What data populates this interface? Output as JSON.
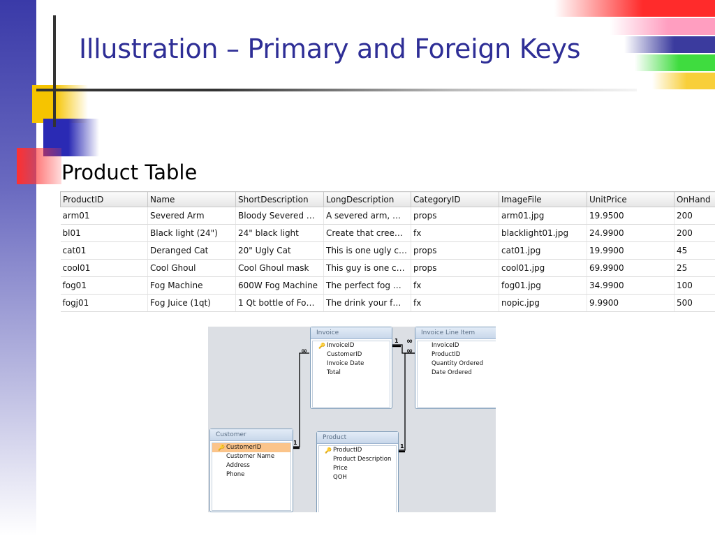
{
  "title": "Illustration – Primary and Foreign Keys",
  "subtitle": "Product Table",
  "product_table": {
    "columns": [
      "ProductID",
      "Name",
      "ShortDescription",
      "LongDescription",
      "CategoryID",
      "ImageFile",
      "UnitPrice",
      "OnHand"
    ],
    "rows": [
      [
        "arm01",
        "Severed Arm",
        "Bloody Severed …",
        "A severed arm, …",
        "props",
        "arm01.jpg",
        "19.9500",
        "200"
      ],
      [
        "bl01",
        "Black light (24\")",
        "24\" black light",
        "Create that cree…",
        "fx",
        "blacklight01.jpg",
        "24.9900",
        "200"
      ],
      [
        "cat01",
        "Deranged Cat",
        "20\" Ugly Cat",
        "This is one ugly cat.",
        "props",
        "cat01.jpg",
        "19.9900",
        "45"
      ],
      [
        "cool01",
        "Cool Ghoul",
        "Cool Ghoul mask",
        "This guy is one c…",
        "props",
        "cool01.jpg",
        "69.9900",
        "25"
      ],
      [
        "fog01",
        "Fog Machine",
        "600W Fog Machine",
        "The perfect fog …",
        "fx",
        "fog01.jpg",
        "34.9900",
        "100"
      ],
      [
        "fogj01",
        "Fog Juice (1qt)",
        "1 Qt bottle of Fo…",
        "The drink your f…",
        "fx",
        "nopic.jpg",
        "9.9900",
        "500"
      ]
    ]
  },
  "diagram": {
    "tables": {
      "invoice": {
        "name": "Invoice",
        "fields": [
          "InvoiceID",
          "CustomerID",
          "Invoice Date",
          "Total"
        ],
        "key_field": "InvoiceID"
      },
      "invoice_line_item": {
        "name": "Invoice Line Item",
        "fields": [
          "InvoiceID",
          "ProductID",
          "Quantity Ordered",
          "Date Ordered"
        ]
      },
      "customer": {
        "name": "Customer",
        "fields": [
          "CustomerID",
          "Customer Name",
          "Address",
          "Phone"
        ],
        "key_field": "CustomerID"
      },
      "product": {
        "name": "Product",
        "fields": [
          "ProductID",
          "Product Description",
          "Price",
          "QOH"
        ],
        "key_field": "ProductID"
      }
    },
    "relationships": {
      "customer_invoice": {
        "one": "1",
        "many": "∞"
      },
      "invoice_lineitem": {
        "one": "1",
        "many": "∞"
      },
      "product_lineitem": {
        "one": "1",
        "many": "∞"
      }
    }
  },
  "icons": {
    "key": "key-icon"
  },
  "colors": {
    "title": "#2e2e96",
    "selected_field": "#fbc48a"
  }
}
